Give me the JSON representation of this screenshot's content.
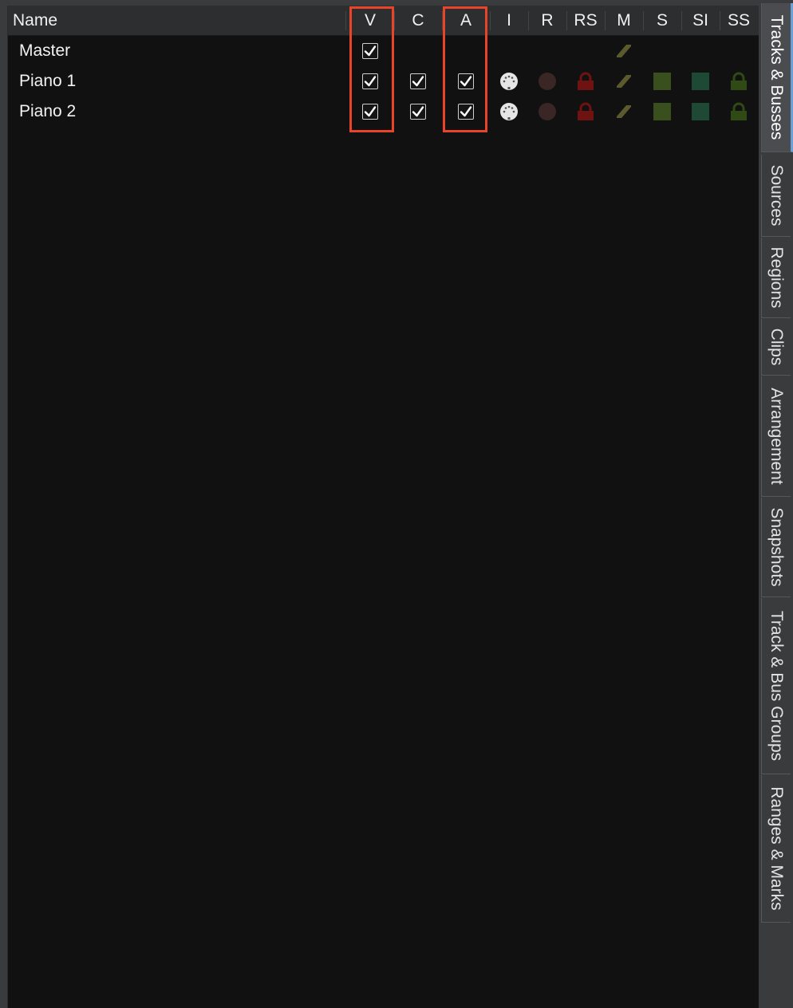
{
  "columns": {
    "name": "Name",
    "visible": "V",
    "color": "C",
    "active": "A",
    "input": "I",
    "record": "R",
    "rec_safe": "RS",
    "mute": "M",
    "solo": "S",
    "solo_isolate": "SI",
    "solo_safe": "SS"
  },
  "tracks": [
    {
      "name": "Master",
      "visible": true,
      "color": null,
      "active": null
    },
    {
      "name": "Piano 1",
      "visible": true,
      "color": true,
      "active": true
    },
    {
      "name": "Piano 2",
      "visible": true,
      "color": true,
      "active": true
    }
  ],
  "tabs": [
    {
      "label": "Tracks & Busses",
      "active": true
    },
    {
      "label": "Sources",
      "active": false
    },
    {
      "label": "Regions",
      "active": false
    },
    {
      "label": "Clips",
      "active": false
    },
    {
      "label": "Arrangement",
      "active": false
    },
    {
      "label": "Snapshots",
      "active": false
    },
    {
      "label": "Track & Bus Groups",
      "active": false
    },
    {
      "label": "Ranges & Marks",
      "active": false
    }
  ],
  "colors": {
    "highlight_box": "#e8442a",
    "record_off": "#3b2626",
    "rec_safe_lock": "#6e1212",
    "mute": "#5b5a2e",
    "solo": "#3a4f1e",
    "solo_isolate": "#1e4a35",
    "solo_safe_lock": "#2f4a14"
  },
  "icons": {
    "check": "checkmark-icon",
    "input": "midi-din-icon",
    "record": "record-circle-icon",
    "rec_safe": "lock-icon",
    "mute": "mute-slash-icon",
    "solo": "solo-square-icon",
    "solo_isolate": "isolate-square-icon",
    "solo_safe": "lock-icon"
  }
}
